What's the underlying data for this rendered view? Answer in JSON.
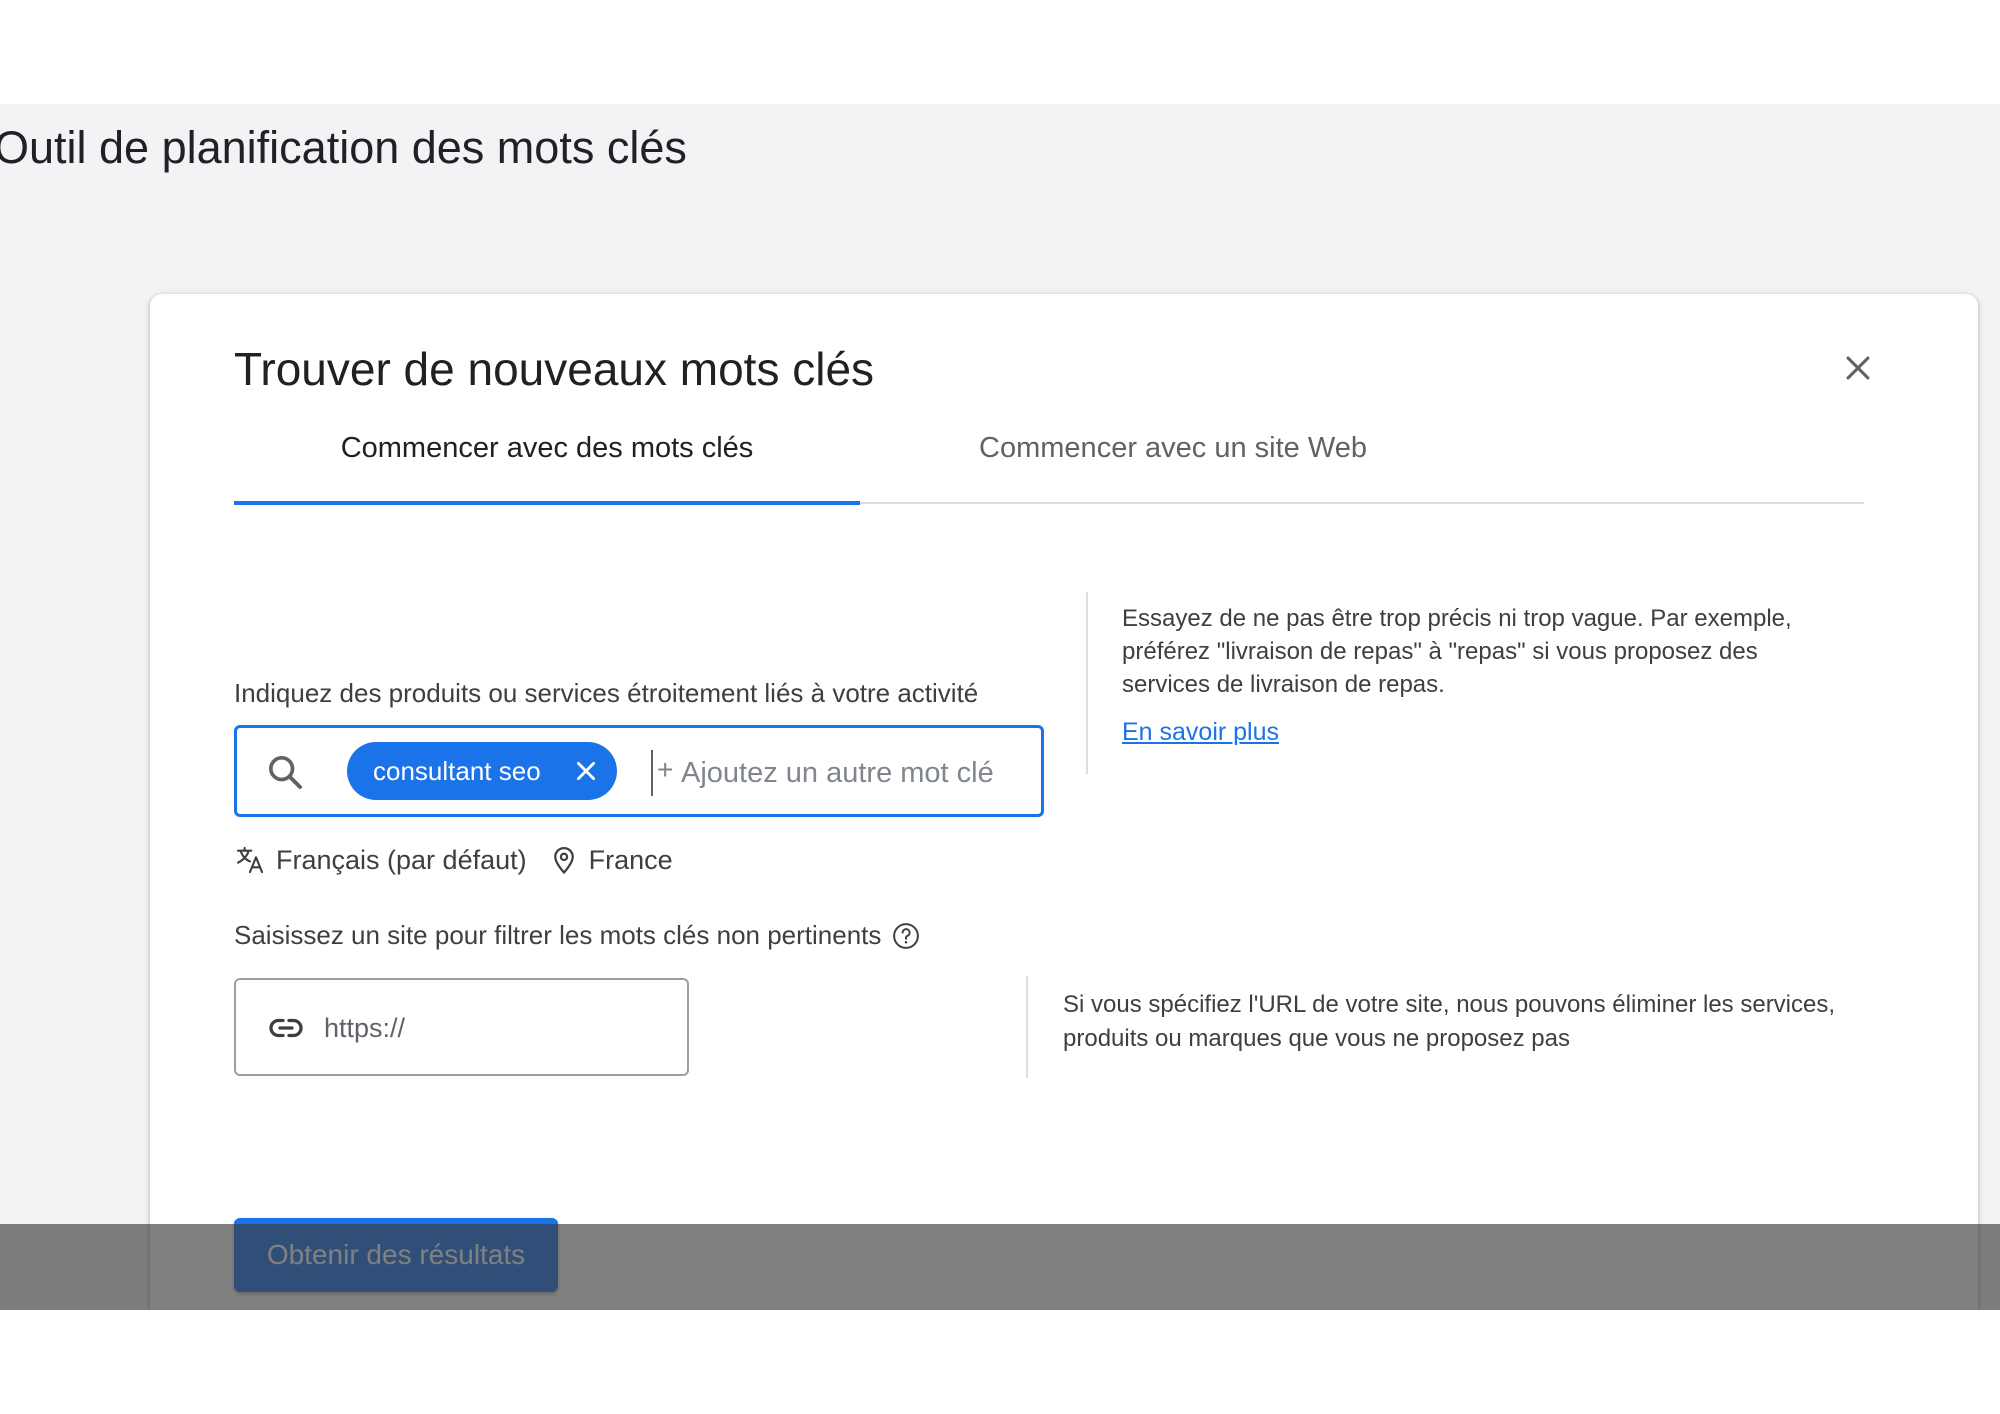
{
  "app": {
    "page_title": "Outil de planification des mots clés"
  },
  "dialog": {
    "title": "Trouver de nouveaux mots clés",
    "close_icon": "close-icon",
    "tabs": [
      {
        "label": "Commencer avec des mots clés",
        "active": true
      },
      {
        "label": "Commencer avec un site Web",
        "active": false
      }
    ],
    "keywords": {
      "label": "Indiquez des produits ou services étroitement liés à votre activité",
      "chip": "consultant seo",
      "placeholder": "Ajoutez un autre mot clé",
      "language": "Français (par défaut)",
      "location": "France"
    },
    "hint_keywords": "Essayez de ne pas être trop précis ni trop vague. Par exemple, préférez \"livraison de repas\" à \"repas\" si vous proposez des services de livraison de repas.",
    "learn_more": "En savoir plus",
    "site": {
      "label": "Saisissez un site pour filtrer les mots clés non pertinents",
      "placeholder": "https://",
      "hint": "Si vous spécifiez l'URL de votre site, nous pouvons éliminer les services, produits ou marques que vous ne proposez pas"
    },
    "submit_label": "Obtenir des résultats"
  },
  "colors": {
    "accent": "#1a73e8",
    "background": "#f1f3f4",
    "text": "#202124"
  }
}
